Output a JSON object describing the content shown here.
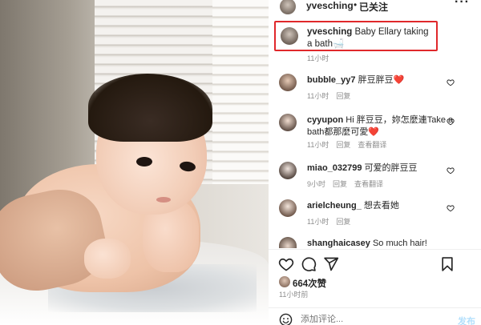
{
  "header": {
    "username": "yvesching",
    "separator": "•",
    "follow_state": "已关注",
    "more_icon": "more-horizontal-icon"
  },
  "caption": {
    "username": "yvesching",
    "text": "Baby Ellary taking a bath🛁",
    "time": "11小时"
  },
  "comments": [
    {
      "username": "bubble_yy7",
      "text": "胖豆胖豆❤️",
      "time": "11小时",
      "reply": "回复",
      "view_translation": ""
    },
    {
      "username": "cyyupon",
      "text": "Hi 胖豆豆，妳怎麼連Take a bath都那麼可愛❤️",
      "time": "11小时",
      "reply": "回复",
      "view_translation": "查看翻译"
    },
    {
      "username": "miao_032799",
      "text": "可爱的胖豆豆",
      "time": "9小时",
      "reply": "回复",
      "view_translation": "查看翻译"
    },
    {
      "username": "arielcheung_",
      "text": "想去看她",
      "time": "11小时",
      "reply": "回复",
      "view_translation": ""
    },
    {
      "username": "shanghaicasey",
      "text": "So much hair!",
      "time": "",
      "reply": "",
      "view_translation": ""
    }
  ],
  "actions": {
    "like_icon": "heart-icon",
    "comment_icon": "comment-icon",
    "share_icon": "send-icon",
    "save_icon": "bookmark-icon"
  },
  "likes": {
    "count_text": "664次赞"
  },
  "post_time": "11小时前",
  "add_comment": {
    "placeholder": "添加评论...",
    "post_label": "发布",
    "emoji_icon": "emoji-icon"
  },
  "colors": {
    "highlight_border": "#e0282b",
    "muted_text": "#8e8e8e",
    "post_button": "#b2dffc",
    "heart_red": "#ed1c24"
  }
}
